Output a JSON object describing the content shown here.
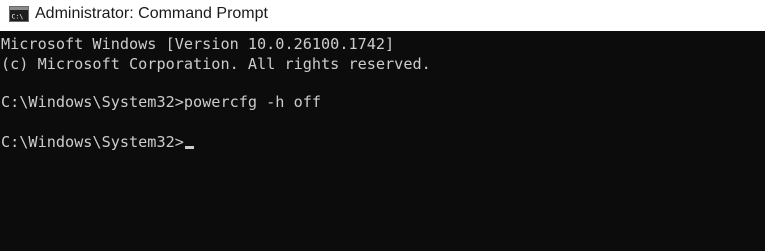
{
  "window": {
    "title": "Administrator: Command Prompt",
    "icon": "cmd-console-icon",
    "icon_label": "C:\\"
  },
  "console": {
    "background_color": "#0c0c0c",
    "text_color": "#cccccc",
    "lines": [
      "Microsoft Windows [Version 10.0.26100.1742]",
      "(c) Microsoft Corporation. All rights reserved.",
      "C:\\Windows\\System32>powercfg -h off",
      "C:\\Windows\\System32>"
    ]
  }
}
